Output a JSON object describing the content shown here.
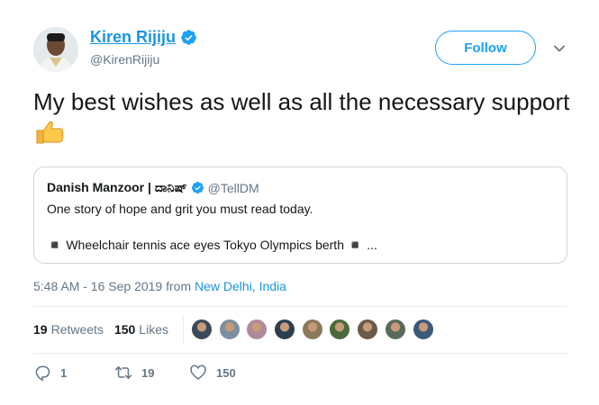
{
  "author": {
    "name": "Kiren Rijiju",
    "handle": "@KirenRijiju"
  },
  "follow_label": "Follow",
  "tweet": {
    "text": "My best wishes as well as all the necessary support"
  },
  "quoted": {
    "name": "Danish Manzoor | ದಾನಿಷ್",
    "handle": "@TellDM",
    "line1": "One story of hope and grit you must read today.",
    "line2": "◾ Wheelchair tennis ace eyes Tokyo Olympics berth ◾ ..."
  },
  "meta": {
    "time_date": "5:48 AM - 16 Sep 2019 from",
    "location": "New Delhi, India"
  },
  "stats": {
    "retweets_count": "19",
    "retweets_label": "Retweets",
    "likes_count": "150",
    "likes_label": "Likes",
    "liker_colors": [
      "#3b4a5a",
      "#7b8fa0",
      "#b08a9a",
      "#2c3e50",
      "#8a7a5a",
      "#4a6a3a",
      "#6a5a4a",
      "#5a6a5a",
      "#3a5a7a"
    ]
  },
  "actions": {
    "reply_count": "1",
    "retweet_count": "19",
    "like_count": "150"
  },
  "colors": {
    "link": "#1b95e0",
    "follow": "#1da1f2",
    "muted": "#657786"
  }
}
